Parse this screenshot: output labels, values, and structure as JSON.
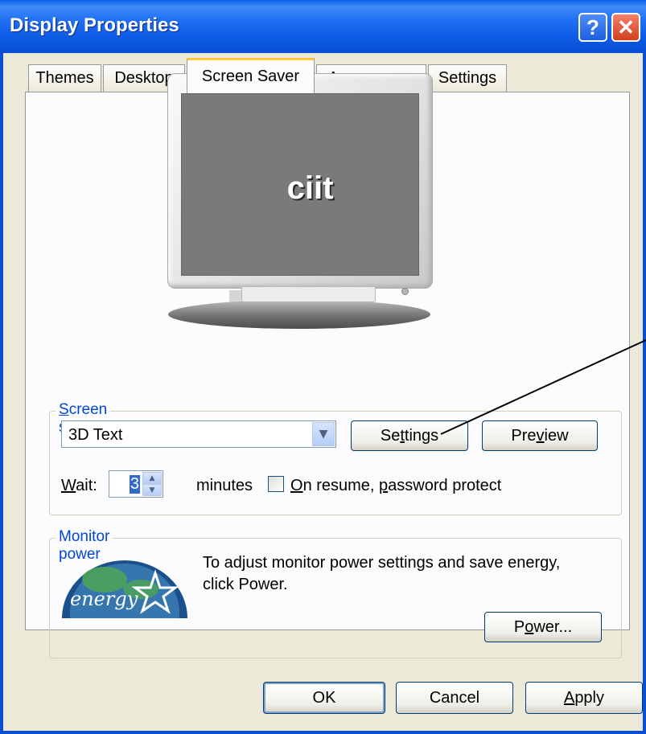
{
  "window": {
    "title": "Display Properties",
    "help_label": "?",
    "close_label": "✕"
  },
  "tabs": [
    {
      "label": "Themes",
      "active": false
    },
    {
      "label": "Desktop",
      "active": false
    },
    {
      "label": "Screen Saver",
      "active": true
    },
    {
      "label": "Appearance",
      "active": false
    },
    {
      "label": "Settings",
      "active": false
    }
  ],
  "preview": {
    "screen_text": "ciit"
  },
  "screen_saver": {
    "legend_prefix": "",
    "legend_u": "S",
    "legend_rest": "creen saver",
    "selected": "3D Text",
    "settings_button": {
      "pre": "Se",
      "u": "t",
      "post": "tings"
    },
    "preview_button": {
      "pre": "Pre",
      "u": "v",
      "post": "iew"
    },
    "wait_label": {
      "u": "W",
      "post": "ait:"
    },
    "wait_value": "3",
    "minutes_label": "minutes",
    "password_label": {
      "pre": "",
      "u": "O",
      "mid": "n resume, ",
      "u2": "p",
      "post": "assword protect"
    },
    "password_checked": false
  },
  "monitor_power": {
    "legend": "Monitor power",
    "description_line1": "To adjust monitor power settings and save energy,",
    "description_line2": "click Power.",
    "power_button": {
      "pre": "P",
      "u": "o",
      "post": "wer..."
    },
    "logo_text": "energy"
  },
  "footer": {
    "ok": "OK",
    "cancel": "Cancel",
    "apply": {
      "u": "A",
      "post": "pply"
    }
  },
  "colors": {
    "titlebar": "#0a5fe6",
    "group_legend": "#0046d5",
    "dialog_bg": "#ece9d8"
  }
}
